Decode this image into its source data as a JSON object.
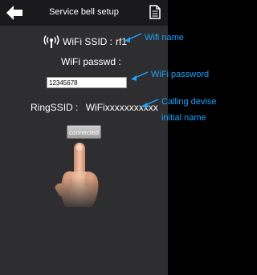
{
  "header": {
    "title": "Service bell setup",
    "back_icon": "back-arrow-icon",
    "doc_icon": "document-icon"
  },
  "wifi": {
    "icon": "wifi-signal-icon",
    "ssid_label": "WiFi SSID :",
    "ssid_value": "rf1",
    "passwd_label": "WiFi passwd :",
    "passwd_value": "12345678"
  },
  "ring": {
    "label": "RingSSID :",
    "value": "WiFixxxxxxxxxxx"
  },
  "connect_button": {
    "label": "connected"
  },
  "annotations": {
    "wifi_name": "Wifi name",
    "wifi_password": "WiFi password",
    "calling_line1": "Calling devise",
    "calling_line2": "initial name",
    "color": "#1aa3ff"
  },
  "colors": {
    "screen_bg": "#2e2e30",
    "topbar_bg": "#1a1a1c",
    "outer_bg": "#000000"
  }
}
